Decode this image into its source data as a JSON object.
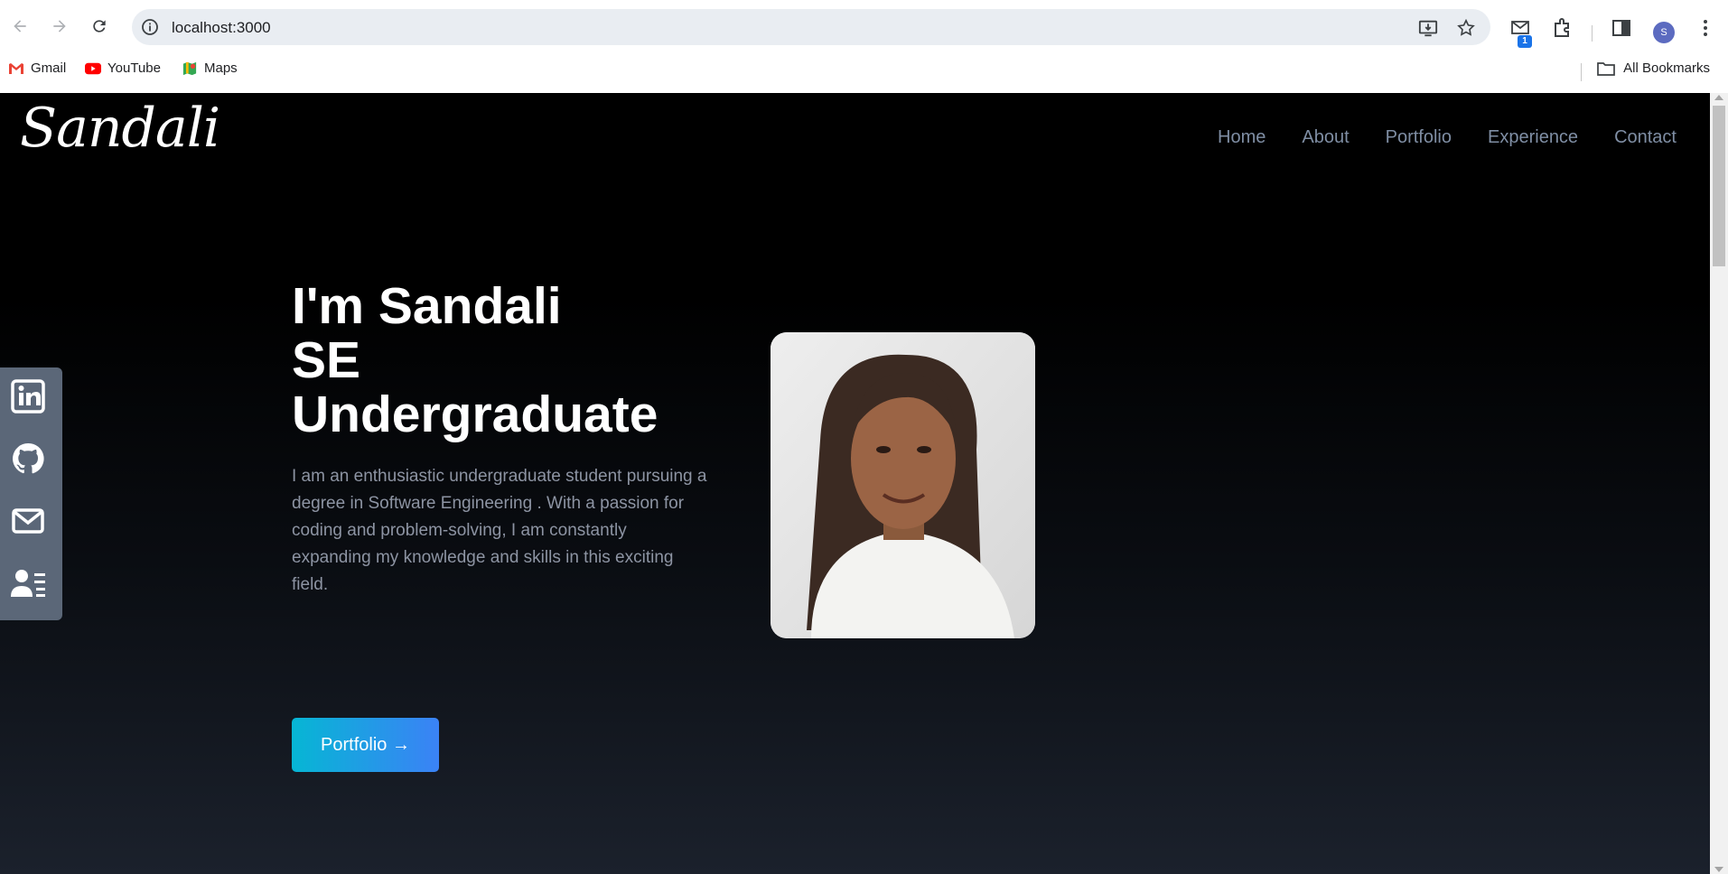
{
  "browser": {
    "url": "localhost:3000",
    "bookmarks": [
      {
        "label": "Gmail",
        "icon": "gmail-icon"
      },
      {
        "label": "YouTube",
        "icon": "youtube-icon"
      },
      {
        "label": "Maps",
        "icon": "maps-icon"
      }
    ],
    "all_bookmarks": "All Bookmarks",
    "extension_badge": "1",
    "profile_initial": "S"
  },
  "site": {
    "logo": "Sandali",
    "nav": [
      "Home",
      "About",
      "Portfolio",
      "Experience",
      "Contact"
    ],
    "hero": {
      "line1": "I'm Sandali",
      "line2": "SE",
      "line3": "Undergraduate",
      "description": "I am an enthusiastic undergraduate student pursuing a degree in Software Engineering . With a passion for coding and problem-solving, I am constantly expanding my knowledge and skills in this exciting field.",
      "button": "Portfolio →"
    },
    "social": [
      "linkedin-icon",
      "github-icon",
      "mail-icon",
      "resume-icon"
    ]
  },
  "colors": {
    "accent_start": "#06b6d4",
    "accent_end": "#3b82f6",
    "nav_text": "#7f8ea4",
    "social_bar": "#5b6778"
  }
}
